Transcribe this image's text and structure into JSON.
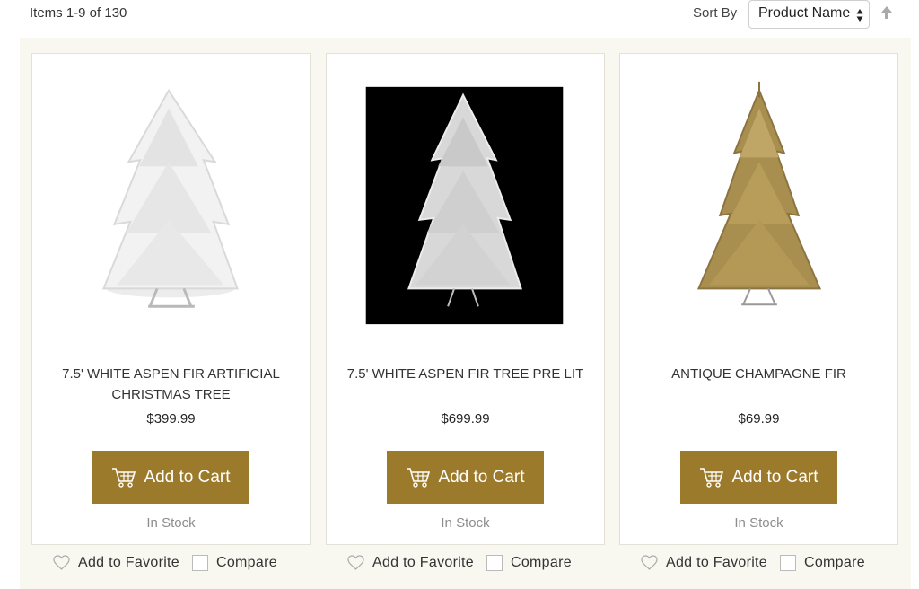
{
  "toolbar": {
    "count_text": "Items 1-9 of 130",
    "sort_label": "Sort By",
    "sort_value": "Product Name"
  },
  "colors": {
    "button": "#9c7a2b",
    "grid_bg": "#f8f7f0",
    "stock_text": "#8d8d8d"
  },
  "products": [
    {
      "name": "7.5' WHITE ASPEN FIR ARTIFICIAL CHRISTMAS TREE",
      "price": "$399.99",
      "add_label": "Add to Cart",
      "stock": "In Stock",
      "favorite_label": "Add to Favorite",
      "compare_label": "Compare"
    },
    {
      "name": "7.5' WHITE ASPEN FIR TREE PRE LIT",
      "price": "$699.99",
      "add_label": "Add to Cart",
      "stock": "In Stock",
      "favorite_label": "Add to Favorite",
      "compare_label": "Compare"
    },
    {
      "name": "ANTIQUE CHAMPAGNE FIR",
      "price": "$69.99",
      "add_label": "Add to Cart",
      "stock": "In Stock",
      "favorite_label": "Add to Favorite",
      "compare_label": "Compare"
    }
  ]
}
